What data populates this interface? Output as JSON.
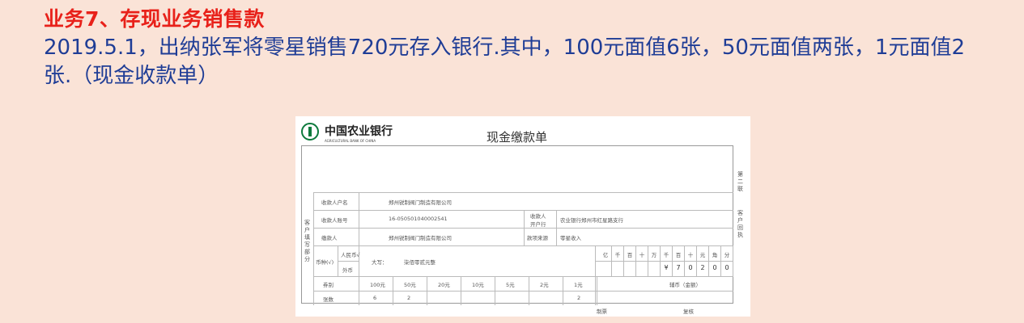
{
  "heading": "业务7、存现业务销售款",
  "description": "2019.5.1，出纳张军将零星销售720元存入银行.其中，100元面值6张，50元面值两张，1元面值2张.（现金收款单）",
  "slip": {
    "bank_name_cn": "中国农业银行",
    "bank_name_en": "AGRICULTURAL BANK OF CHINA",
    "form_title": "现金缴款单",
    "right_side_label_1": "第二联",
    "right_side_label_2": "客户回执",
    "left_side_label": "客户填写部分",
    "payee_name_label": "收款人户名",
    "payee_name_value": "郑州锐制阀门制造有限公司",
    "payee_account_label": "收款人账号",
    "payee_account_value": "16-050501040002541",
    "payee_bank_label_1": "收款人",
    "payee_bank_label_2": "开户行",
    "payee_bank_value": "农业银行郑州市红星路支行",
    "payer_label": "缴款人",
    "payer_value": "郑州锐制阀门制造有限公司",
    "source_label": "款项来源",
    "source_value": "零星收入",
    "currency_label": "币种(√)",
    "currency_rmb": "人民币√",
    "currency_foreign": "外币",
    "capital_label": "大写：",
    "capital_value": "柒佰零贰元整",
    "units": [
      "亿",
      "千",
      "百",
      "十",
      "万",
      "千",
      "百",
      "十",
      "元",
      "角",
      "分"
    ],
    "amount_digits": [
      "",
      "",
      "",
      "",
      "",
      "¥",
      "7",
      "0",
      "2",
      "0",
      "0"
    ],
    "denom_label": "券别",
    "denominations": [
      "100元",
      "50元",
      "20元",
      "10元",
      "5元",
      "2元",
      "1元"
    ],
    "count_label": "张数",
    "counts": [
      "6",
      "2",
      "",
      "",
      "",
      "",
      "2"
    ],
    "coin_label": "辅币（金额）",
    "maker_label": "制票",
    "checker_label": "复核"
  }
}
